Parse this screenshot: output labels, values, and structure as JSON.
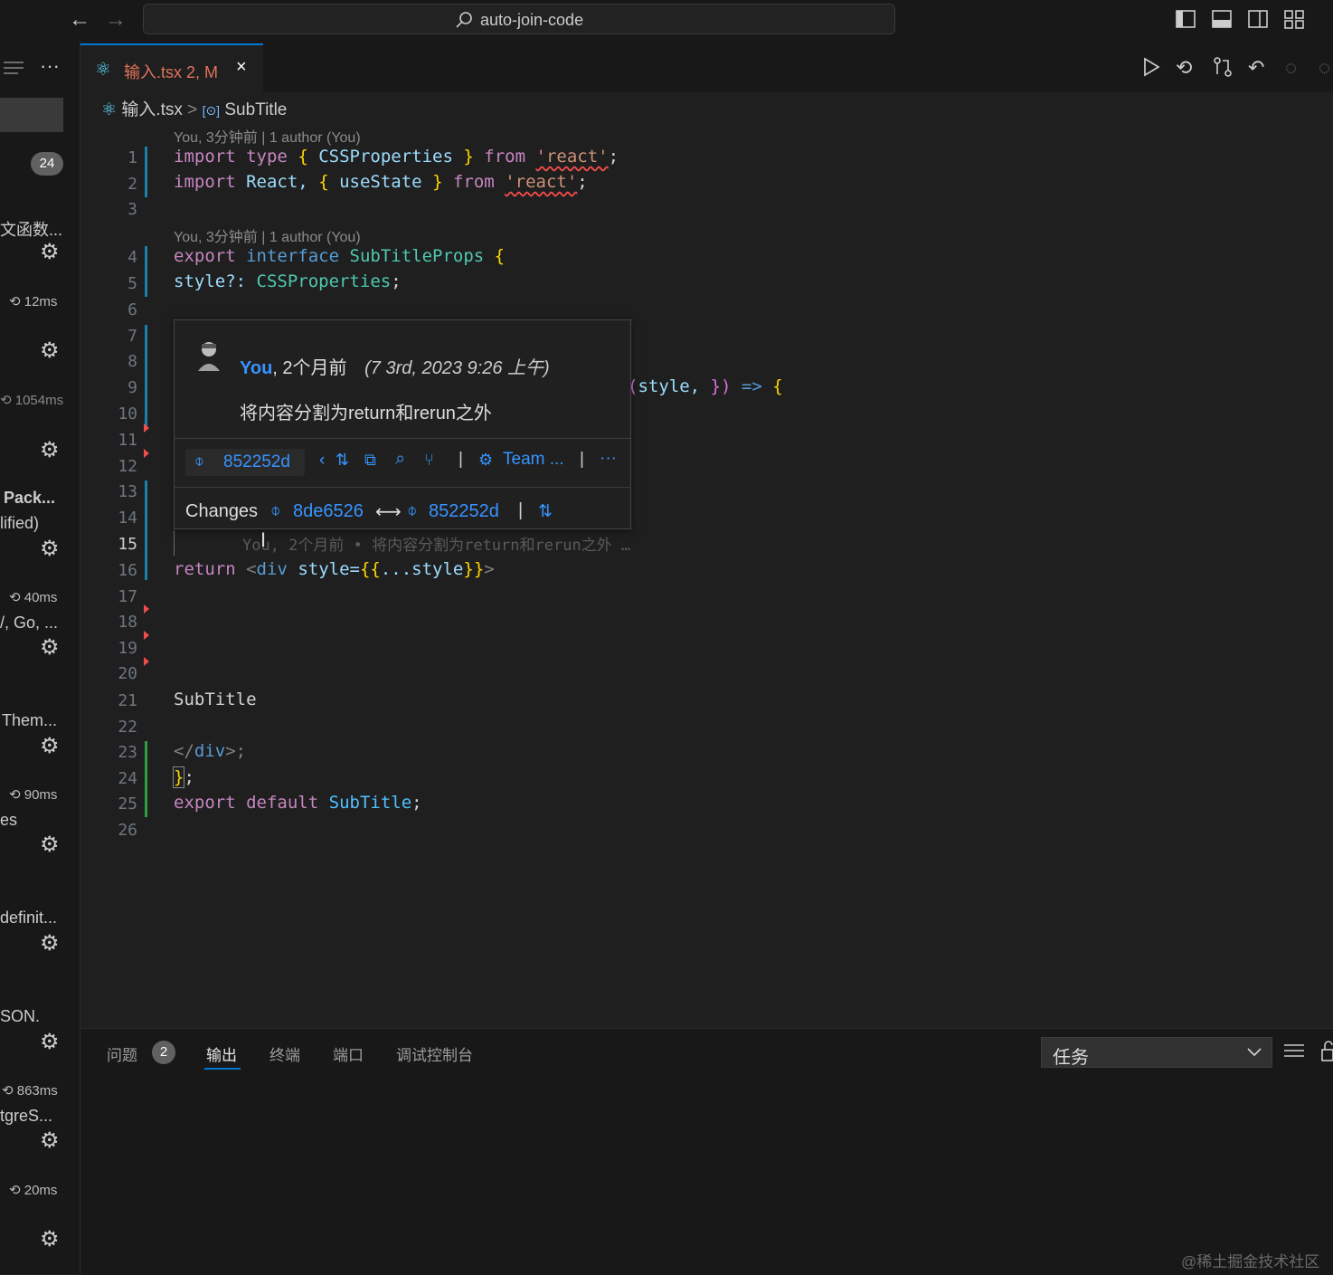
{
  "titlebar": {
    "back_icon": "←",
    "forward_icon": "→",
    "search_text": "auto-join-code"
  },
  "sidebar": {
    "badge_count": "24",
    "items": [
      {
        "label": "文函数...",
        "time": "12ms"
      },
      {
        "label": "",
        "time": "1054ms"
      },
      {
        "label": "Pack...",
        "sub": "lified)",
        "time": "40ms"
      },
      {
        "label": "/, Go, ...",
        "time": ""
      },
      {
        "label": "Them...",
        "time": "90ms"
      },
      {
        "label": "es",
        "time": ""
      },
      {
        "label": "definit...",
        "time": ""
      },
      {
        "label": "SON.",
        "time": "863ms"
      },
      {
        "label": "tgreS...",
        "time": "20ms"
      }
    ]
  },
  "tab": {
    "filename": "输入.tsx",
    "status": "2, M",
    "close": "×"
  },
  "breadcrumb": {
    "file": "输入.tsx",
    "separator": ">",
    "symbol": "SubTitle"
  },
  "codelens": {
    "top": "You, 3分钟前 | 1 author (You)",
    "interface": "You, 3分钟前 | 1 author (You)"
  },
  "line_numbers": [
    "1",
    "2",
    "3",
    "4",
    "5",
    "6",
    "7",
    "8",
    "9",
    "10",
    "11",
    "12",
    "13",
    "14",
    "15",
    "16",
    "17",
    "18",
    "19",
    "20",
    "21",
    "22",
    "23",
    "24",
    "25",
    "26"
  ],
  "code": {
    "l1": {
      "a": "import",
      "b": "type",
      "c": "{",
      "d": "CSSProperties",
      "e": "}",
      "f": "from",
      "g": "'react'",
      "h": ";"
    },
    "l2": {
      "a": "import",
      "b": "React,",
      "c": "{",
      "d": "useState",
      "e": "}",
      "f": "from",
      "g": "'react'",
      "h": ";"
    },
    "l4": {
      "a": "export",
      "b": "interface",
      "c": "SubTitleProps",
      "d": "{"
    },
    "l5": {
      "a": "style?:",
      "b": "CSSProperties",
      ";": ";"
    },
    "l9": {
      "a": "(",
      "b": "style,",
      "c": "})",
      "d": "=>",
      "e": "{"
    },
    "l15_ghost": "You, 2个月前 • 将内容分割为return和rerun之外 …",
    "l16": {
      "a": "return",
      "b": "<",
      "c": "div",
      "d": "style=",
      "e": "{{",
      "f": "...style",
      "g": "}}",
      "h": ">"
    },
    "l21": "SubTitle",
    "l23": {
      "a": "</",
      "b": "div",
      "c": ">;"
    },
    "l24": {
      "a": "}",
      ";": ";"
    },
    "l25": {
      "a": "export",
      "b": "default",
      "c": "SubTitle",
      ";": ";"
    }
  },
  "hover": {
    "author": "You",
    "age": ", 2个月前",
    "date": "(7 3rd, 2023 9:26 上午)",
    "message": "将内容分割为return和rerun之外",
    "commit": "852252d",
    "team": "Team ...",
    "more": "···",
    "changes_label": "Changes",
    "from_commit": "8de6526",
    "arrow": "⟷",
    "to_commit": "852252d",
    "pipe": "|"
  },
  "panel": {
    "tabs": [
      {
        "label": "问题",
        "badge": "2"
      },
      {
        "label": "输出"
      },
      {
        "label": "终端"
      },
      {
        "label": "端口"
      },
      {
        "label": "调试控制台"
      }
    ],
    "task_select": "任务"
  },
  "watermark": "@稀土掘金技术社区"
}
